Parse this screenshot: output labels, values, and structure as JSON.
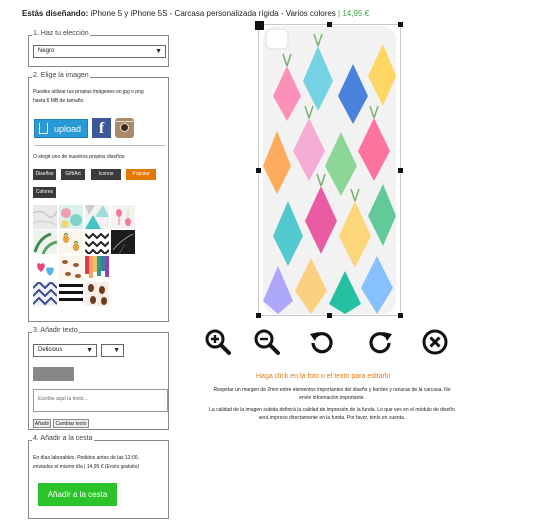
{
  "header": {
    "designing_label": "Estás diseñando:",
    "product": "iPhone 5 y iPhone 5S - Carcasa personalizada rígida - Varios colores",
    "separator": "|",
    "price": "14,95 €"
  },
  "step1": {
    "legend": "1. Haz tu elección",
    "color_select": {
      "value": "Negro"
    }
  },
  "step2": {
    "legend": "2. Elige la imagen",
    "intro_line1": "Puedes utilizar tus propias imágenes en jpg o png",
    "intro_line2": "hasta 6 MB de tamaño.",
    "upload_label": "upload",
    "facebook_letter": "f",
    "or_text": "O elegir uno de nuestros propios diseños:",
    "categories": [
      {
        "label": "Diseños",
        "active": false
      },
      {
        "label": "Gift/Art",
        "active": false
      },
      {
        "label": "Iconos",
        "active": false
      },
      {
        "label": "Popular",
        "active": true
      },
      {
        "label": "Colores",
        "active": false
      }
    ],
    "thumbnails": [
      {
        "icon": "marble-pattern-thumb"
      },
      {
        "icon": "tropical-watercolor-thumb"
      },
      {
        "icon": "turquoise-triangles-thumb"
      },
      {
        "icon": "flamingo-pattern-thumb"
      },
      {
        "icon": "palm-leaves-thumb"
      },
      {
        "icon": "pineapple-pattern-thumb"
      },
      {
        "icon": "chevron-zigzag-thumb"
      },
      {
        "icon": "black-marble-thumb"
      },
      {
        "icon": "hearts-balloons-thumb"
      },
      {
        "icon": "cookies-pattern-thumb"
      },
      {
        "icon": "paint-drips-thumb"
      },
      {
        "icon": "geometric-aztec-thumb"
      },
      {
        "icon": "black-white-stripes-thumb"
      },
      {
        "icon": "coffee-beans-thumb"
      }
    ]
  },
  "step3": {
    "legend": "3. Añadir texto",
    "font_select": {
      "value": "Delicious"
    },
    "size_select": {
      "value": ""
    },
    "text_color": "#888888",
    "textarea_placeholder": "Escribe aquí tu texto...",
    "add_button": "Añadir",
    "change_button": "Cambiar texto"
  },
  "step4": {
    "legend": "4. Añadir a la cesta",
    "shipping_line1": "En días laborables. Pedidos antes de las 13:00,",
    "shipping_line2": "enviados el mismo día | 14,95 € (Envío gratuito)",
    "add_to_cart": "Añadir a la cesta"
  },
  "preview": {
    "case_design_icon": "watercolor-pineapples-case"
  },
  "tools": [
    {
      "icon": "zoom-in-icon"
    },
    {
      "icon": "zoom-out-icon"
    },
    {
      "icon": "rotate-left-icon"
    },
    {
      "icon": "rotate-right-icon"
    },
    {
      "icon": "delete-icon"
    }
  ],
  "hint": "Haga click en la foto o el texto para editarlo",
  "notes": {
    "margin_line1": "Respetar un margen de 2mm entre elementos importantes del diseño y bordes y ranuras de la carcasa. No",
    "margin_line2": "envíe información importante.",
    "quality_line1": "La calidad de la imagen subida definirá la calidad de impresión de la funda. Lo que ves en el módulo de diseño",
    "quality_line2": "será impreso directamente en la funda. Por favor, tenlo en cuenta."
  },
  "colors": {
    "accent_orange": "#e57700",
    "price_green": "#3aa535",
    "cta_green": "#2cc32a",
    "upload_blue": "#2a9ad7",
    "facebook_blue": "#3b5998"
  }
}
